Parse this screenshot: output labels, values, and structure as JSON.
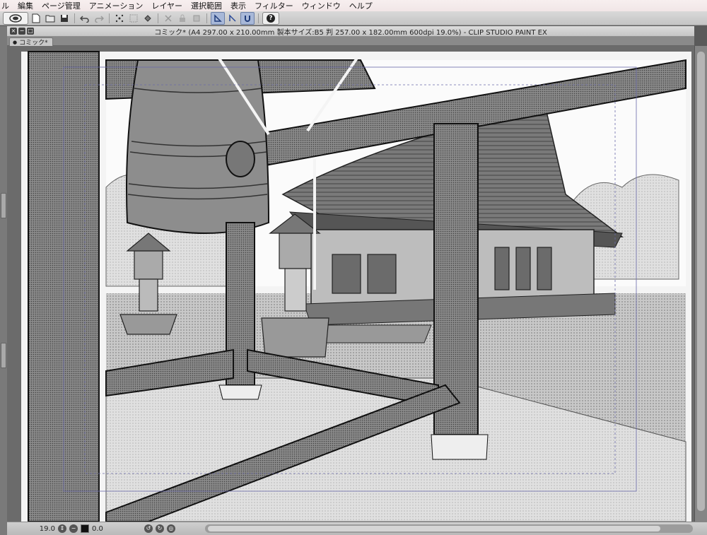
{
  "menu": {
    "items": [
      "ル",
      "編集",
      "ページ管理",
      "アニメーション",
      "レイヤー",
      "選択範囲",
      "表示",
      "フィルター",
      "ウィンドウ",
      "ヘルプ"
    ]
  },
  "toolbar": {
    "icons": [
      "app-logo-icon",
      "new-file-icon",
      "open-folder-icon",
      "save-icon",
      "undo-icon",
      "redo-icon",
      "transform-icon",
      "selection-icon",
      "fill-icon",
      "clear-icon",
      "lock-icon",
      "perspective-ruler-icon",
      "snap-icon",
      "magnet-icon",
      "help-icon"
    ]
  },
  "window": {
    "title": "コミック* (A4 297.00 x 210.00mm 製本サイズ:B5 判 257.00 x 182.00mm 600dpi 19.0%)  - CLIP STUDIO PAINT EX",
    "tab_label": "コミック*"
  },
  "status": {
    "zoom": "19.0",
    "angle": "0.0"
  },
  "colors": {
    "menubar": "#f2e8e9",
    "toolbar": "#cccccc",
    "canvas_bg": "#6b6b6b",
    "active_tool": "#a8b8d8"
  }
}
